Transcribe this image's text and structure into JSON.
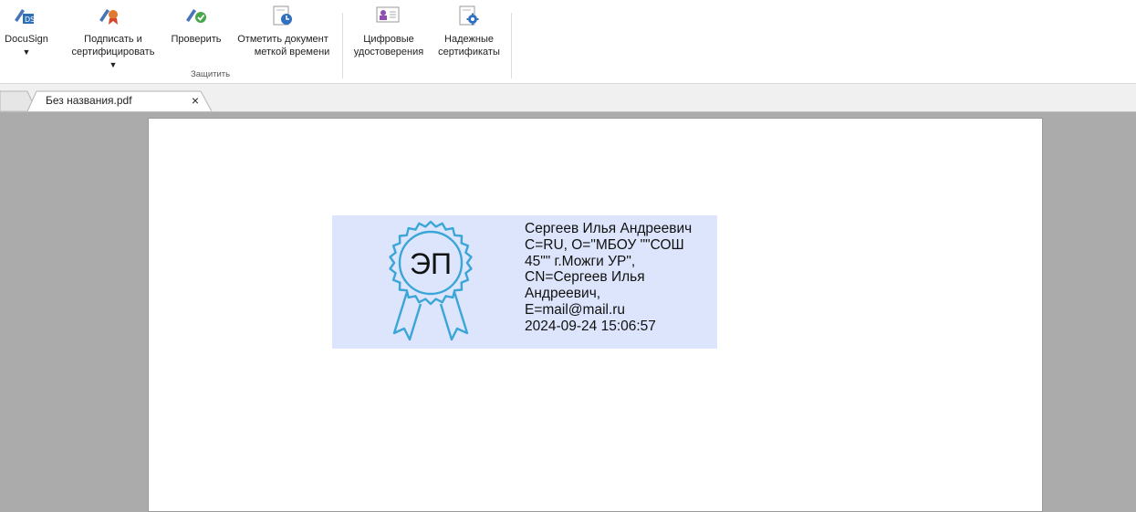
{
  "ribbon": {
    "buttons": [
      {
        "id": "docusign",
        "lines": [
          "DocuSign"
        ],
        "caret": true
      },
      {
        "id": "sign_certify",
        "lines": [
          "Подписать и",
          "сертифицировать"
        ],
        "caret": true
      },
      {
        "id": "verify",
        "lines": [
          "Проверить"
        ]
      },
      {
        "id": "timestamp",
        "lines": [
          "Отметить документ",
          "меткой времени"
        ]
      },
      {
        "id": "digital_ids",
        "lines": [
          "Цифровые",
          "удостоверения"
        ]
      },
      {
        "id": "trusted_certs",
        "lines": [
          "Надежные",
          "сертификаты"
        ]
      }
    ],
    "group_label": "Защитить"
  },
  "tabs": [
    {
      "title": "Без названия.pdf",
      "close_glyph": "×"
    }
  ],
  "stamp": {
    "seal_text": "ЭП",
    "lines": [
      "Сергеев Илья Андреевич",
      "C=RU, O=\"МБОУ \"\"СОШ",
      "45\"\" г.Можги УР\",",
      "CN=Сергеев Илья",
      "Андреевич,",
      "E=mail@mail.ru",
      "2024-09-24 15:06:57"
    ]
  },
  "colors": {
    "seal_stroke": "#3aa6d8",
    "stamp_bg": "#dce5fb",
    "workspace_bg": "#ababab"
  }
}
